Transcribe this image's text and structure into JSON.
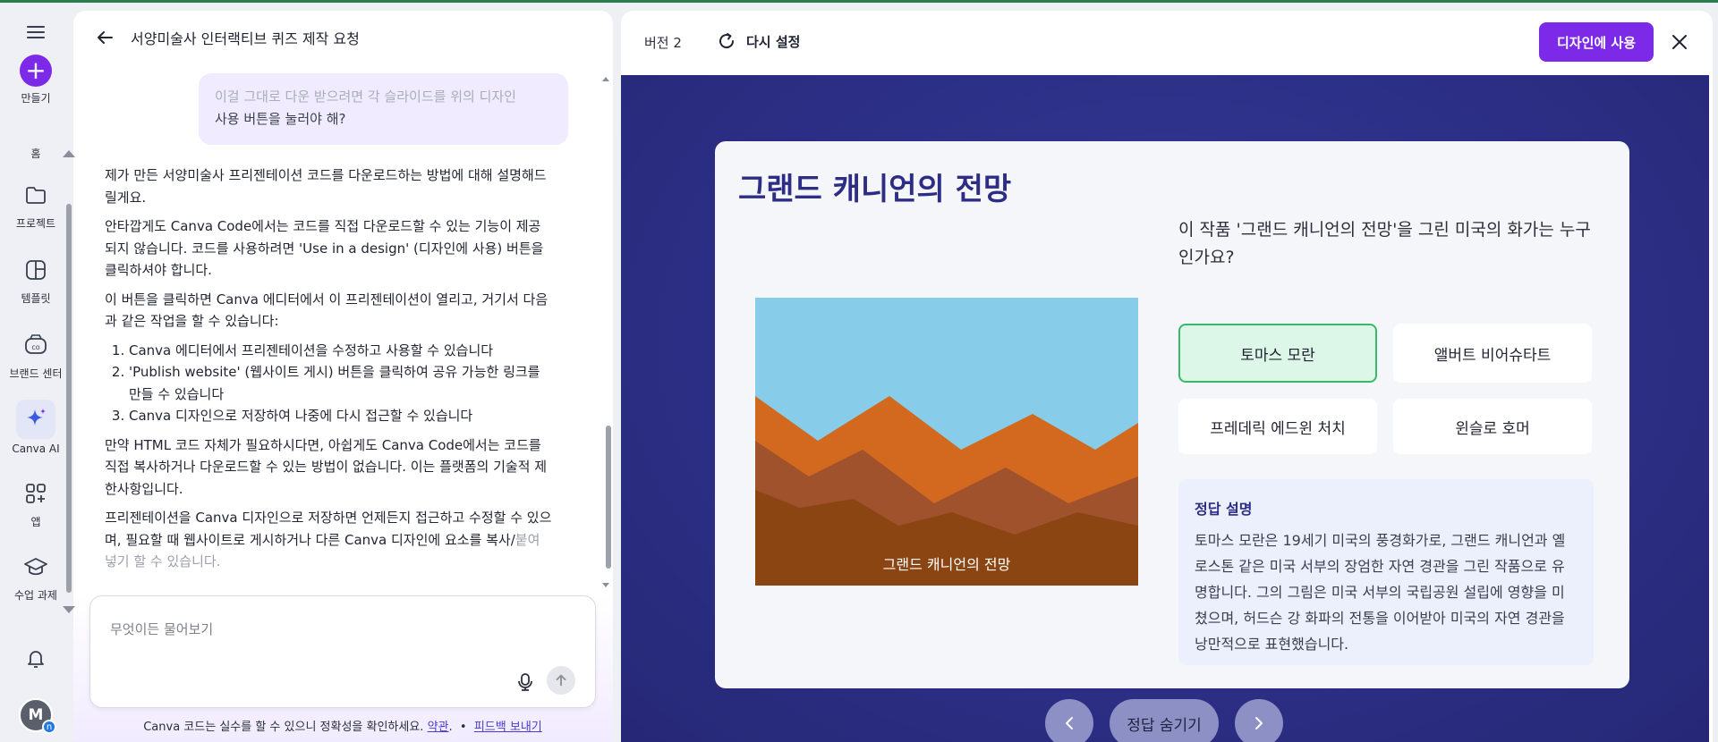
{
  "rail": {
    "create_label": "만들기",
    "home_label": "홈",
    "projects_label": "프로젝트",
    "templates_label": "템플릿",
    "brand_label": "브랜드 센터",
    "ai_label": "Canva AI",
    "apps_label": "앱",
    "classwork_label": "수업 과제",
    "avatar_initial": "M",
    "avatar_badge": "n"
  },
  "chat": {
    "title": "서양미술사 인터랙티브 퀴즈 제작 요청",
    "user_message_faded": "이걸 그대로 다운 받으려면 각 슬라이드를 위의 디자인",
    "user_message": "사용 버튼을 눌러야 해?",
    "reply": {
      "p1": "제가 만든 서양미술사 프리젠테이션 코드를 다운로드하는 방법에 대해 설명해드릴게요.",
      "p2": "안타깝게도 Canva Code에서는 코드를 직접 다운로드할 수 있는 기능이 제공되지 않습니다. 코드를 사용하려면 'Use in a design' (디자인에 사용) 버튼을 클릭하셔야 합니다.",
      "p3": "이 버튼을 클릭하면 Canva 에디터에서 이 프리젠테이션이 열리고, 거기서 다음과 같은 작업을 할 수 있습니다:",
      "list": [
        "Canva 에디터에서 프리젠테이션을 수정하고 사용할 수 있습니다",
        "'Publish website' (웹사이트 게시) 버튼을 클릭하여 공유 가능한 링크를 만들 수 있습니다",
        "Canva 디자인으로 저장하여 나중에 다시 접근할 수 있습니다"
      ],
      "p4": "만약 HTML 코드 자체가 필요하시다면, 아쉽게도 Canva Code에서는 코드를 직접 복사하거나 다운로드할 수 있는 방법이 없습니다. 이는 플랫폼의 기술적 제한사항입니다.",
      "p5a": "프리젠테이션을 Canva 디자인으로 저장하면 언제든지 접근하고 수정할 수 있으며, 필요할 때 웹사이트로 게시하거나 다른 Canva 디자인에 요소를 복사/",
      "p5b": "붙여넣기 할 수 있습니다."
    },
    "input_placeholder": "무엇이든 물어보기",
    "footer_text": "Canva 코드는 실수를 할 수 있으니 정확성을 확인하세요.",
    "footer_terms": "약관",
    "footer_sep": ".  •  ",
    "footer_feedback": "피드백 보내기"
  },
  "preview": {
    "version": "버전 2",
    "reset_label": "다시 설정",
    "use_button": "디자인에 사용",
    "slide": {
      "title": "그랜드 캐니언의 전망",
      "painting_caption": "그랜드 캐니언의 전망",
      "question": "이 작품 '그랜드 캐니언의 전망'을 그린 미국의 화가는 누구인가요?",
      "options": [
        "토마스 모란",
        "앨버트 비어슈타트",
        "프레데릭 에드윈 처치",
        "윈슬로 호머"
      ],
      "selected_option": 0,
      "explain_title": "정답 설명",
      "explain_text": "토마스 모란은 19세기 미국의 풍경화가로, 그랜드 캐니언과 옐로스톤 같은 미국 서부의 장엄한 자연 경관을 그린 작품으로 유명합니다. 그의 그림은 미국 서부의 국립공원 설립에 영향을 미쳤으며, 허드슨 강 화파의 전통을 이어받아 미국의 자연 경관을 낭만적으로 표현했습니다."
    },
    "hide_answer": "정답 숨기기"
  },
  "colors": {
    "accent": "#7d2ae8",
    "slide_bg": "#2c2f86",
    "correct": "#3ab86a",
    "sky": "#87cdea",
    "canyon_light": "#d2691e",
    "canyon_mid": "#a0522d",
    "canyon_dark": "#8b4513"
  }
}
